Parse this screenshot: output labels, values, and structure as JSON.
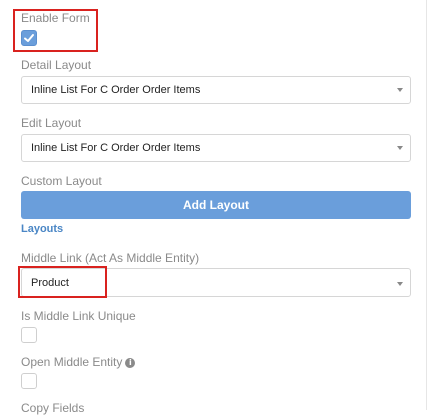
{
  "form": {
    "enable_form": {
      "label": "Enable Form",
      "checked": true
    },
    "detail_layout": {
      "label": "Detail Layout",
      "value": "Inline List For C Order Order Items"
    },
    "edit_layout": {
      "label": "Edit Layout",
      "value": "Inline List For C Order Order Items"
    },
    "custom_layout": {
      "label": "Custom Layout",
      "button": "Add Layout",
      "link": "Layouts"
    },
    "middle_link": {
      "label": "Middle Link (Act As Middle Entity)",
      "value": "Product"
    },
    "middle_link_unique": {
      "label": "Is Middle Link Unique",
      "checked": false
    },
    "open_middle_entity": {
      "label": "Open Middle Entity",
      "info": "i",
      "checked": false
    },
    "copy_fields": {
      "label": "Copy Fields"
    }
  },
  "colors": {
    "accent": "#6a9edb",
    "highlight": "#d9221f",
    "link": "#4a86c5"
  }
}
